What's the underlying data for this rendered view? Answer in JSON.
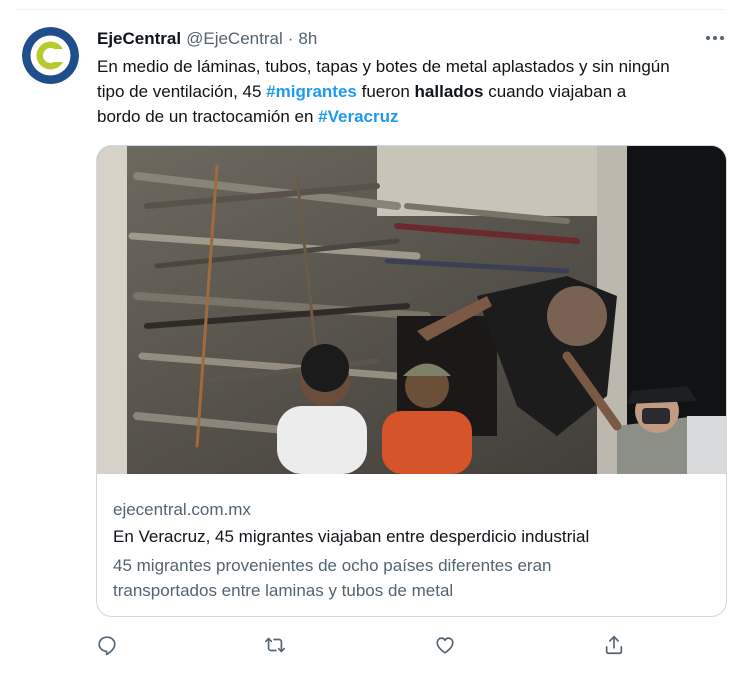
{
  "tweet": {
    "display_name": "EjeCentral",
    "handle": "@EjeCentral",
    "separator": "·",
    "time": "8h",
    "text": {
      "line1": "En medio de láminas, tubos, tapas y botes de metal aplastados y sin ningún",
      "line2_pre": "tipo de ventilación, 45 ",
      "hashtag_migrantes": "#migrantes",
      "line2_mid": " fueron ",
      "bold_hallados": "hallados",
      "line2_post": " cuando viajaban a",
      "line3_pre": "bordo de un tractocamión en ",
      "hashtag_veracruz": "#Veracruz"
    }
  },
  "card": {
    "domain": "ejecentral.com.mx",
    "title": "En Veracruz, 45 migrantes viajaban entre desperdicio industrial",
    "desc_line1": "45 migrantes provenientes de ocho países diferentes eran",
    "desc_line2": "transportados entre laminas y tubos de metal"
  },
  "icons": {
    "reply": "reply-icon",
    "retweet": "retweet-icon",
    "like": "like-icon",
    "share": "share-icon",
    "more": "more-icon"
  },
  "colors": {
    "hashtag": "#1d9bf0",
    "secondary_text": "#536471",
    "border": "#cfd9de",
    "avatar_blue": "#1f4e8c",
    "avatar_green": "#b5cc2a"
  }
}
